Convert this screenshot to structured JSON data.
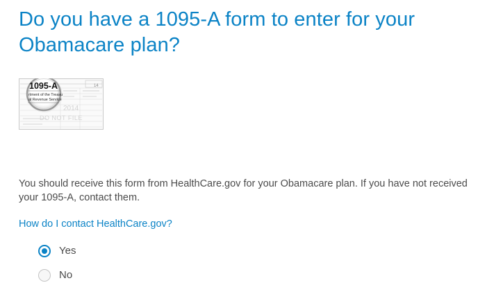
{
  "heading": "Do you have a 1095-A form to enter for your Obamacare plan?",
  "form_image": {
    "icon": "form-1095a-magnifier-icon",
    "lens_title": "1095-A",
    "lens_line1": "rtment of the Treasu",
    "lens_line2": "al Revenue Service",
    "corner_code": "14",
    "watermark_year": "2014",
    "watermark_text": "DO NOT FILE"
  },
  "description": "You should receive this form from HealthCare.gov for your Obamacare plan. If you have not received your 1095-A, contact them.",
  "contact_link": "How do I contact HealthCare.gov?",
  "options": [
    {
      "label": "Yes",
      "selected": true
    },
    {
      "label": "No",
      "selected": false
    }
  ],
  "colors": {
    "accent": "#0b83c6",
    "body_text": "#4a4a4a"
  }
}
